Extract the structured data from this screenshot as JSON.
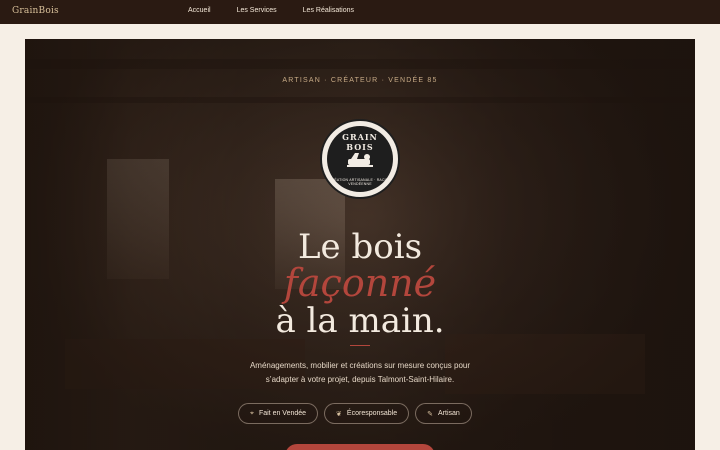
{
  "header": {
    "brand": "GrainBois",
    "nav": [
      "Accueil",
      "Les Services",
      "Les Réalisations"
    ]
  },
  "hero": {
    "eyebrow": "ARTISAN · CRÉATEUR · VENDÉE 85",
    "logo": {
      "top": "GRAIN BOIS",
      "bottom": "CRÉATION ARTISANALE · RACINE VENDÉENNE"
    },
    "title_line1": "Le bois",
    "title_line2": "façonné",
    "title_line3": "à la main.",
    "description_line1": "Aménagements, mobilier et créations sur mesure conçus pour",
    "description_line2": "s’adapter à votre projet, depuis Talmont‑Saint‑Hilaire.",
    "pills": [
      {
        "label": "Fait en Vendée",
        "icon": "location-icon"
      },
      {
        "label": "Écoresponsable",
        "icon": "leaf-icon"
      },
      {
        "label": "Artisan",
        "icon": "tool-icon"
      }
    ]
  },
  "colors": {
    "accent": "#b3463c",
    "nav_bg": "#2a1a12",
    "page_bg": "#f6efe6"
  }
}
